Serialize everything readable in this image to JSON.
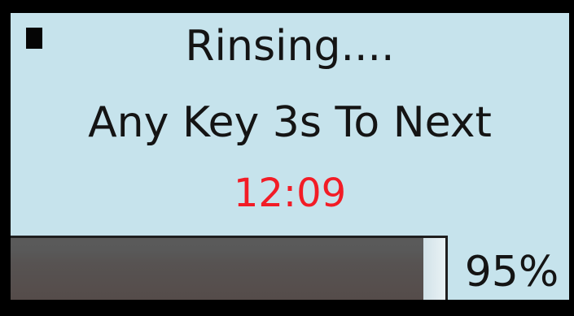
{
  "screen": {
    "status_text": "Rinsing....",
    "hint_text": "Any Key 3s To Next",
    "timer_text": "12:09"
  },
  "progress": {
    "value": 0.95,
    "label": "95%"
  },
  "colors": {
    "panel_background": "#c6e3ec",
    "frame": "#000000",
    "timer_text": "#f21c26",
    "progress_fill": "#575352",
    "text": "#141414"
  },
  "icons": {
    "indicator": "status-indicator-square-icon"
  }
}
